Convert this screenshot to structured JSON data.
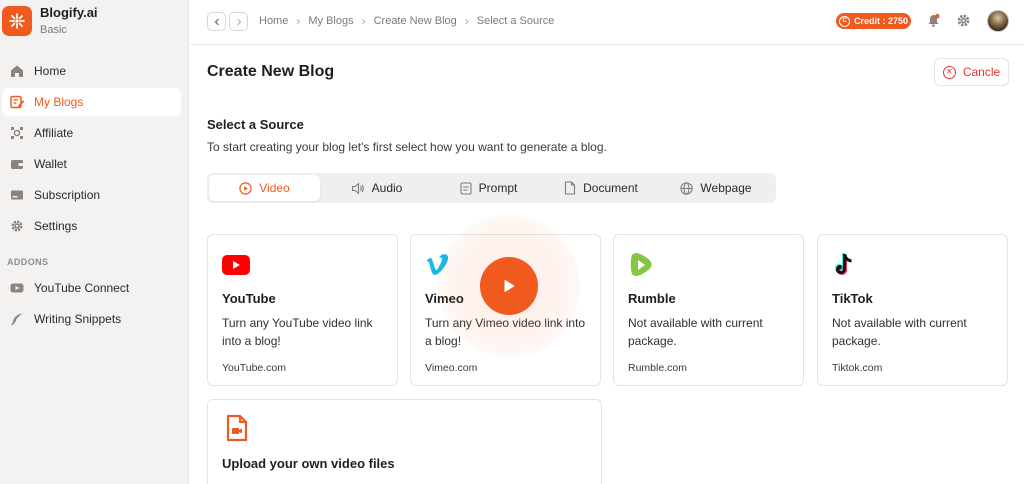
{
  "brand": {
    "name": "Blogify.ai",
    "plan": "Basic"
  },
  "sidebar": {
    "items": [
      {
        "label": "Home",
        "icon": "home-icon"
      },
      {
        "label": "My Blogs",
        "icon": "blog-edit-icon",
        "active": true
      },
      {
        "label": "Affiliate",
        "icon": "affiliate-icon"
      },
      {
        "label": "Wallet",
        "icon": "wallet-icon"
      },
      {
        "label": "Subscription",
        "icon": "subscription-icon"
      },
      {
        "label": "Settings",
        "icon": "gear-icon"
      }
    ],
    "addons_label": "ADDONS",
    "addons": [
      {
        "label": "YouTube Connect",
        "icon": "youtube-icon"
      },
      {
        "label": "Writing Snippets",
        "icon": "feather-icon"
      }
    ]
  },
  "topbar": {
    "breadcrumb": [
      "Home",
      "My Blogs",
      "Create New Blog",
      "Select a Source"
    ],
    "credit": "Credit : 2750"
  },
  "main": {
    "title": "Create New Blog",
    "cancel_label": "Cancle",
    "section_title": "Select a Source",
    "section_desc": "To start creating your blog let's first select how you want to generate a blog.",
    "tabs": [
      {
        "label": "Video",
        "icon": "play-circle-icon",
        "active": true
      },
      {
        "label": "Audio",
        "icon": "speaker-icon"
      },
      {
        "label": "Prompt",
        "icon": "prompt-icon"
      },
      {
        "label": "Document",
        "icon": "document-icon"
      },
      {
        "label": "Webpage",
        "icon": "globe-icon"
      }
    ],
    "cards": [
      {
        "name": "YouTube",
        "desc": "Turn any YouTube video link into a blog!",
        "site": "YouTube.com"
      },
      {
        "name": "Vimeo",
        "desc": "Turn any Vimeo video link into a blog!",
        "site": "Vimeo.com"
      },
      {
        "name": "Rumble",
        "desc": "Not available with current package.",
        "site": "Rumble.com"
      },
      {
        "name": "TikTok",
        "desc": "Not available with current package.",
        "site": "Tiktok.com"
      }
    ],
    "upload": {
      "name": "Upload your own video files"
    }
  },
  "colors": {
    "accent": "#f05a1e",
    "danger": "#e8322d",
    "sidebar_bg": "#f4f2f0"
  }
}
